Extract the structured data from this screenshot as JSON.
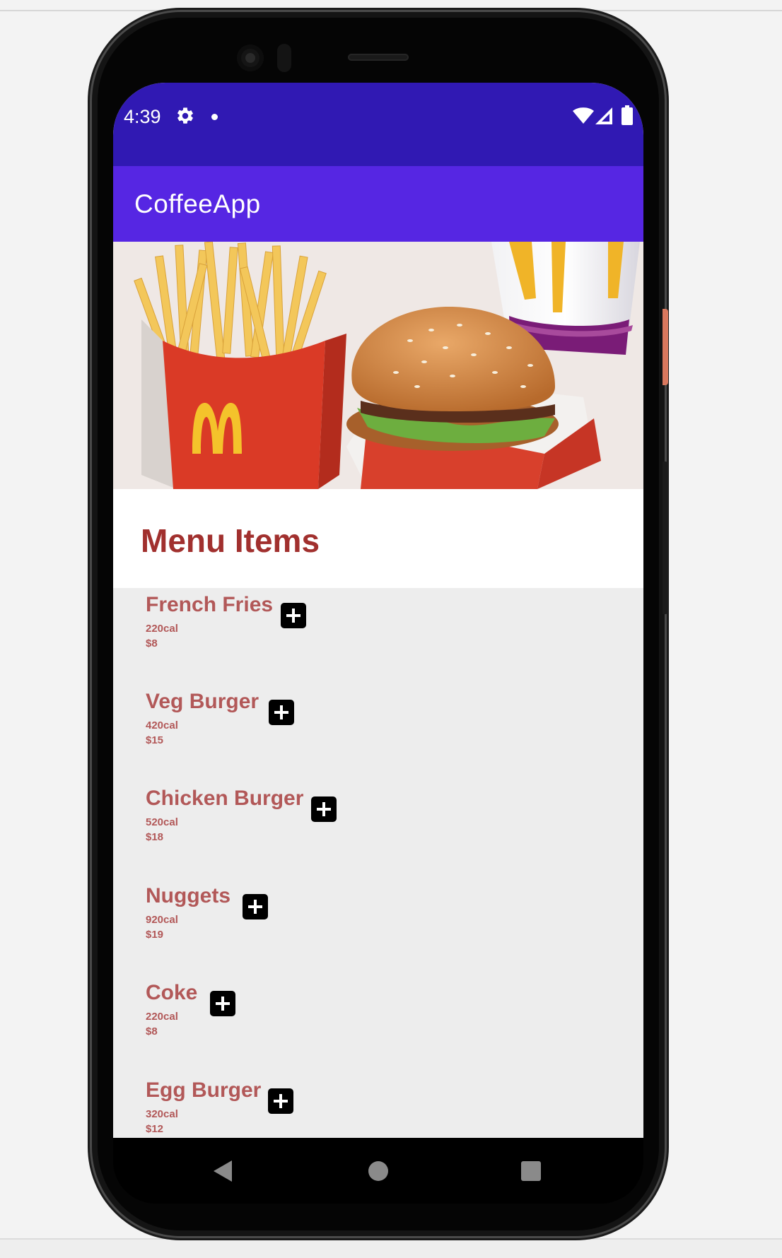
{
  "status_bar": {
    "time": "4:39"
  },
  "app_bar": {
    "title": "CoffeeApp"
  },
  "menu": {
    "title": "Menu Items",
    "items": [
      {
        "name": "French Fries",
        "calories": "220cal",
        "price": "$8"
      },
      {
        "name": "Veg Burger",
        "calories": "420cal",
        "price": "$15"
      },
      {
        "name": "Chicken Burger",
        "calories": "520cal",
        "price": "$18"
      },
      {
        "name": "Nuggets",
        "calories": "920cal",
        "price": "$19"
      },
      {
        "name": "Coke",
        "calories": "220cal",
        "price": "$8"
      },
      {
        "name": "Egg Burger",
        "calories": "320cal",
        "price": "$12"
      }
    ]
  },
  "icons": {
    "status": [
      "gear-icon",
      "dot-icon",
      "wifi-icon",
      "signal-icon",
      "battery-icon"
    ],
    "nav": [
      "back-icon",
      "home-icon",
      "recents-icon"
    ],
    "item_action": "plus-icon"
  },
  "colors": {
    "status_bar": "#3019b3",
    "app_bar": "#5626e3",
    "menu_title": "#a1302e",
    "item_text": "#b25858",
    "list_background": "#ededed",
    "add_button": "#000000"
  }
}
